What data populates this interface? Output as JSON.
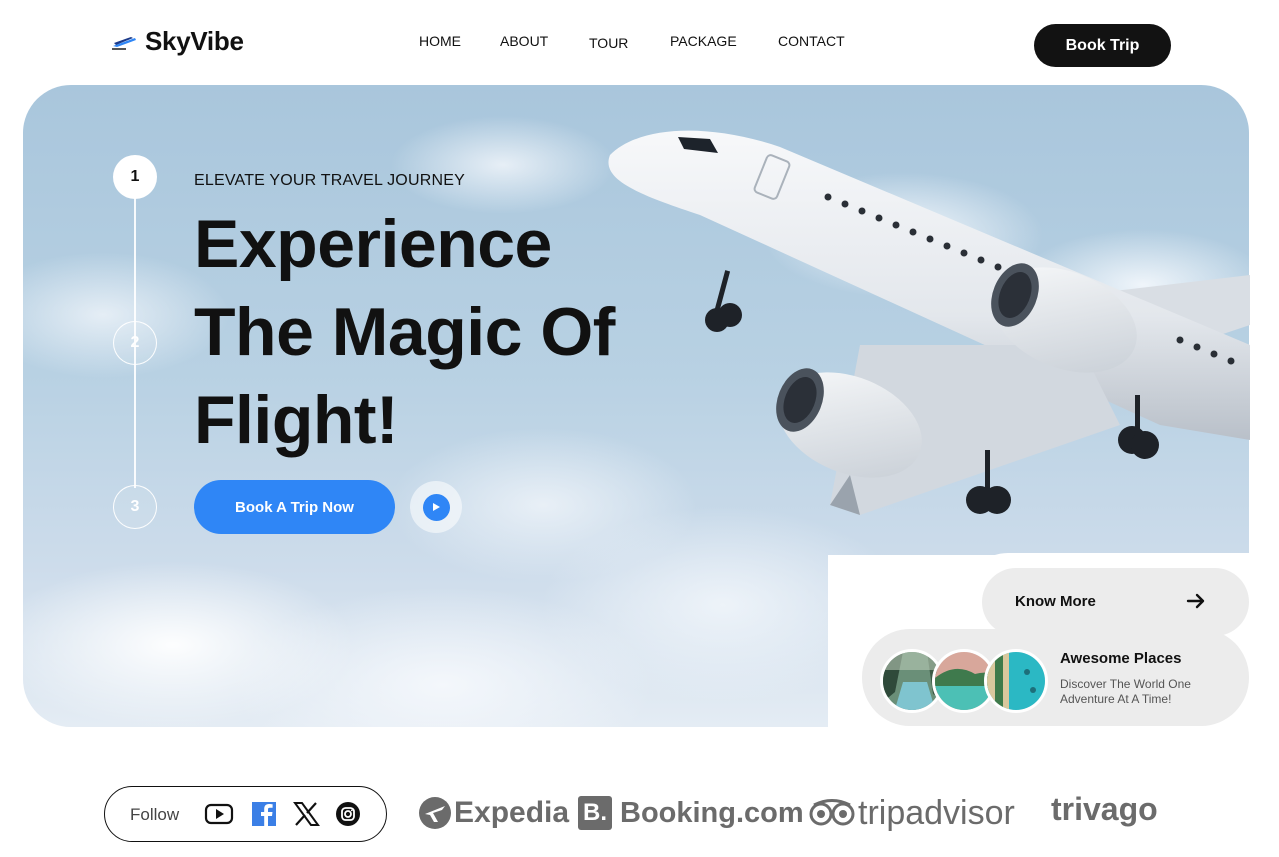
{
  "header": {
    "brand": "SkyVibe",
    "nav": [
      "HOME",
      "ABOUT",
      "TOUR",
      "PACKAGE",
      "CONTACT"
    ],
    "cta": "Book Trip"
  },
  "hero": {
    "steps": [
      "1",
      "2",
      "3"
    ],
    "active_step": 1,
    "eyebrow": "ELEVATE YOUR TRAVEL JOURNEY",
    "headline": "Experience The Magic Of Flight!",
    "cta": "Book A Trip Now"
  },
  "cards": {
    "know_more": "Know More",
    "places_title": "Awesome Places",
    "places_subtitle": "Discover The World One Adventure At A Time!"
  },
  "footer_bar": {
    "follow_label": "Follow",
    "social_icons": [
      "youtube-icon",
      "facebook-icon",
      "x-icon",
      "instagram-icon"
    ],
    "partners": [
      "Expedia",
      "Booking.com",
      "tripadvisor",
      "trivago"
    ]
  },
  "colors": {
    "accent": "#2f86f6",
    "dark": "#121212",
    "card_bg": "#ececec",
    "partner_gray": "#6b6b6b"
  }
}
